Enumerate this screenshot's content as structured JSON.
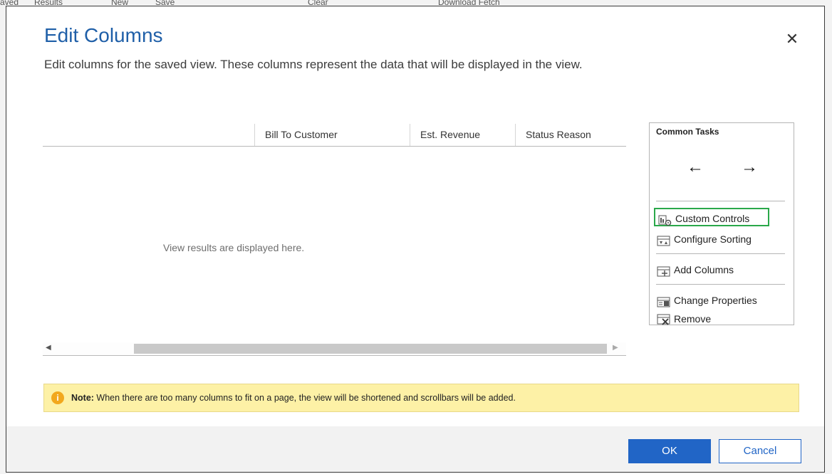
{
  "background": {
    "top_labels": [
      "aved",
      "Results",
      "New",
      "Save",
      "Clear",
      "Download Fetch"
    ]
  },
  "dialog": {
    "title": "Edit Columns",
    "subtitle": "Edit columns for the saved view. These columns represent the data that will be displayed in the view.",
    "close_icon": "close-icon"
  },
  "grid": {
    "columns": [
      "Bill To Customer",
      "Est. Revenue",
      "Status Reason"
    ],
    "empty_message": "View results are displayed here."
  },
  "common_tasks": {
    "title": "Common Tasks",
    "move_left_icon": "arrow-left-icon",
    "move_right_icon": "arrow-right-icon",
    "items": [
      {
        "label": "Custom Controls",
        "icon": "custom-controls-icon",
        "highlighted": true
      },
      {
        "label": "Configure Sorting",
        "icon": "configure-sorting-icon"
      },
      {
        "label": "Add Columns",
        "icon": "add-columns-icon"
      },
      {
        "label": "Change Properties",
        "icon": "change-properties-icon"
      },
      {
        "label": "Remove",
        "icon": "remove-icon"
      }
    ]
  },
  "note": {
    "label": "Note:",
    "text": " When there are too many columns to fit on a page, the view will be shortened and scrollbars will be added."
  },
  "footer": {
    "ok_label": "OK",
    "cancel_label": "Cancel"
  },
  "colors": {
    "accent": "#2165c6",
    "title": "#1f5fa8",
    "note_bg": "#fdf1a6",
    "highlight": "#2aa84a"
  }
}
